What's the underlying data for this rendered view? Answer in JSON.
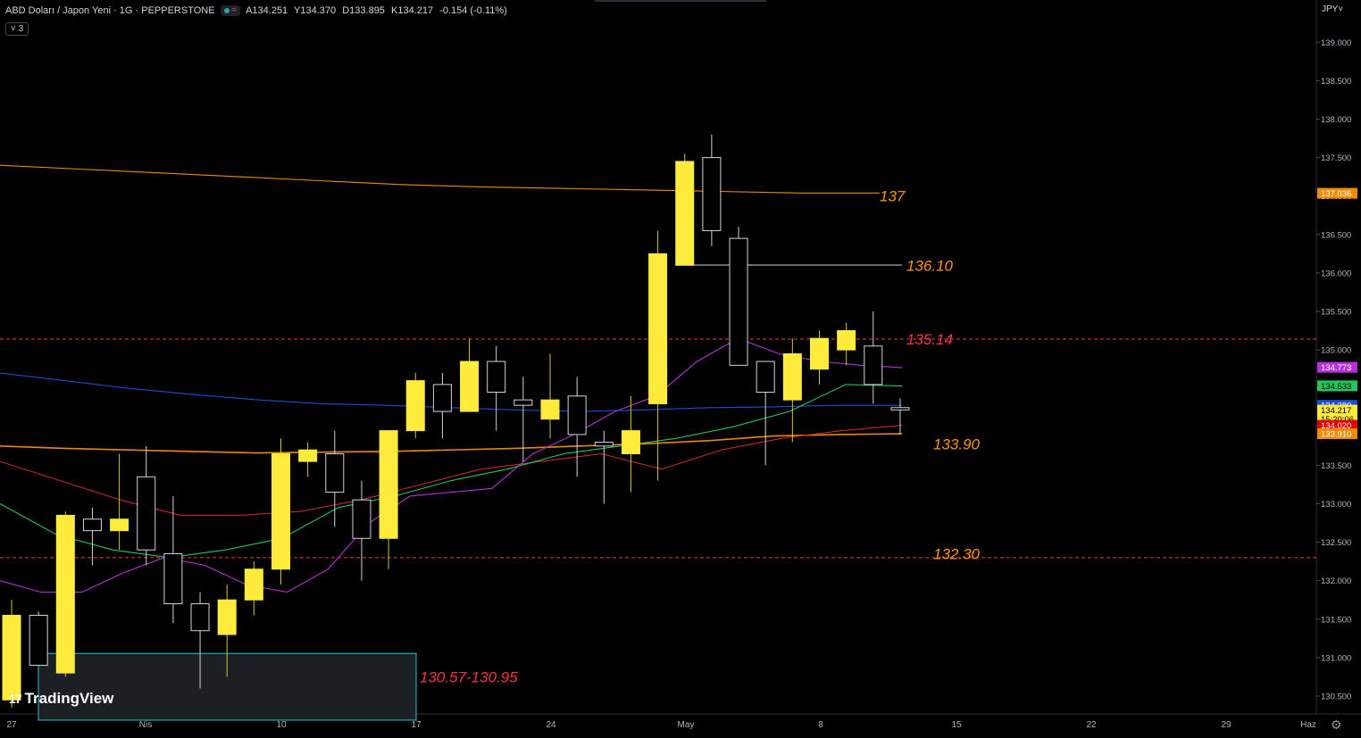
{
  "header": {
    "symbol": "ABD Doları / Japon Yeni · 1G · PEPPERSTONE",
    "ohlc": {
      "open": "A134.251",
      "high": "Y134.370",
      "low": "D133.895",
      "close": "K134.217",
      "change": "-0.154 (-0.11%)"
    },
    "indicator_count": "˅ 3",
    "currency": "JPY˅"
  },
  "branding": {
    "logo_mark": "17",
    "logo_text": "TradingView"
  },
  "colors": {
    "background": "#000000",
    "bull_body": "#ffeb3b",
    "bear_body": "#000000",
    "ma_orange": "#f08c00",
    "ma_blue": "#1a4fd6",
    "ma_red": "#c62828",
    "ma_green": "#22c55e",
    "ma_purple": "#b532d8",
    "annotation_orange": "#ff9800",
    "annotation_red": "#f23645"
  },
  "chart_data": {
    "type": "candlestick",
    "x_ticks": [
      "27",
      "Nis",
      "10",
      "17",
      "24",
      "May",
      "8",
      "15",
      "22",
      "29",
      "Haz"
    ],
    "y_ticks": [
      "130.500",
      "131.000",
      "131.500",
      "132.000",
      "132.500",
      "133.000",
      "133.500",
      "134.000",
      "134.500",
      "135.000",
      "135.500",
      "136.000",
      "136.500",
      "137.000",
      "137.500",
      "138.000",
      "138.500",
      "139.000"
    ],
    "ylim": [
      130.3,
      139.35
    ],
    "candles": [
      {
        "date": "03-23",
        "o": 130.45,
        "h": 131.75,
        "l": 130.35,
        "c": 131.55
      },
      {
        "date": "03-24",
        "o": 131.55,
        "h": 131.6,
        "l": 130.9,
        "c": 130.9
      },
      {
        "date": "03-27",
        "o": 130.8,
        "h": 132.9,
        "l": 130.75,
        "c": 132.85
      },
      {
        "date": "03-28",
        "o": 132.8,
        "h": 132.95,
        "l": 132.2,
        "c": 132.65
      },
      {
        "date": "03-29",
        "o": 132.65,
        "h": 133.65,
        "l": 132.4,
        "c": 132.8
      },
      {
        "date": "03-30",
        "o": 133.35,
        "h": 133.75,
        "l": 132.2,
        "c": 132.4
      },
      {
        "date": "03-31",
        "o": 132.35,
        "h": 133.1,
        "l": 131.45,
        "c": 131.7
      },
      {
        "date": "04-03",
        "o": 131.7,
        "h": 131.85,
        "l": 130.6,
        "c": 131.35
      },
      {
        "date": "04-04",
        "o": 131.3,
        "h": 131.95,
        "l": 130.75,
        "c": 131.75
      },
      {
        "date": "04-05",
        "o": 131.75,
        "h": 132.25,
        "l": 131.55,
        "c": 132.15
      },
      {
        "date": "04-06",
        "o": 132.15,
        "h": 133.85,
        "l": 131.95,
        "c": 133.65
      },
      {
        "date": "04-07",
        "o": 133.55,
        "h": 133.8,
        "l": 133.35,
        "c": 133.7
      },
      {
        "date": "04-10",
        "o": 133.65,
        "h": 133.95,
        "l": 132.7,
        "c": 133.15
      },
      {
        "date": "04-11",
        "o": 133.05,
        "h": 133.3,
        "l": 132.0,
        "c": 132.55
      },
      {
        "date": "04-12",
        "o": 132.55,
        "h": 133.95,
        "l": 132.15,
        "c": 133.95
      },
      {
        "date": "04-13",
        "o": 133.95,
        "h": 134.7,
        "l": 133.85,
        "c": 134.6
      },
      {
        "date": "04-14",
        "o": 134.55,
        "h": 134.7,
        "l": 133.85,
        "c": 134.2
      },
      {
        "date": "04-17",
        "o": 134.2,
        "h": 135.15,
        "l": 134.2,
        "c": 134.85
      },
      {
        "date": "04-18",
        "o": 134.85,
        "h": 135.05,
        "l": 133.95,
        "c": 134.45
      },
      {
        "date": "04-19",
        "o": 134.35,
        "h": 134.65,
        "l": 133.55,
        "c": 134.28
      },
      {
        "date": "04-20",
        "o": 134.1,
        "h": 134.95,
        "l": 133.85,
        "c": 134.35
      },
      {
        "date": "04-21",
        "o": 134.4,
        "h": 134.65,
        "l": 133.35,
        "c": 133.9
      },
      {
        "date": "04-24",
        "o": 133.8,
        "h": 133.95,
        "l": 133.0,
        "c": 133.75
      },
      {
        "date": "04-25",
        "o": 133.65,
        "h": 134.4,
        "l": 133.15,
        "c": 133.95
      },
      {
        "date": "04-26",
        "o": 134.3,
        "h": 136.55,
        "l": 133.3,
        "c": 136.25
      },
      {
        "date": "04-27",
        "o": 136.1,
        "h": 137.55,
        "l": 136.1,
        "c": 137.45
      },
      {
        "date": "04-28",
        "o": 137.5,
        "h": 137.8,
        "l": 136.35,
        "c": 136.55
      },
      {
        "date": "05-01",
        "o": 136.45,
        "h": 136.6,
        "l": 135.15,
        "c": 134.8
      },
      {
        "date": "05-02",
        "o": 134.85,
        "h": 134.85,
        "l": 133.5,
        "c": 134.45
      },
      {
        "date": "05-03",
        "o": 134.35,
        "h": 135.15,
        "l": 133.8,
        "c": 134.95
      },
      {
        "date": "05-04",
        "o": 134.75,
        "h": 135.25,
        "l": 134.55,
        "c": 135.15
      },
      {
        "date": "05-05",
        "o": 135.0,
        "h": 135.35,
        "l": 134.8,
        "c": 135.25
      },
      {
        "date": "05-08",
        "o": 135.05,
        "h": 135.5,
        "l": 134.3,
        "c": 134.55
      },
      {
        "date": "05-09",
        "o": 134.25,
        "h": 134.37,
        "l": 133.9,
        "c": 134.22
      }
    ],
    "moving_averages": [
      {
        "color": "#f08c00",
        "values": [
          137.4,
          137.35,
          137.3,
          137.25,
          137.2,
          137.15,
          137.12,
          137.1,
          137.08,
          137.06,
          137.04,
          137.04
        ]
      },
      {
        "color": "#1a4fd6",
        "values": [
          134.7,
          134.6,
          134.5,
          134.42,
          134.35,
          134.3,
          134.28,
          134.25,
          134.22,
          134.2,
          134.22,
          134.25,
          134.26,
          134.28,
          134.28
        ]
      },
      {
        "color": "#e8870e",
        "values": [
          133.75,
          133.72,
          133.7,
          133.68,
          133.66,
          133.67,
          133.68,
          133.7,
          133.72,
          133.75,
          133.78,
          133.82,
          133.88,
          133.9,
          133.91
        ]
      },
      {
        "color": "#c62828",
        "values": [
          133.55,
          133.3,
          133.05,
          132.85,
          132.85,
          132.9,
          133.05,
          133.25,
          133.45,
          133.55,
          133.65,
          133.45,
          133.7,
          133.85,
          133.95,
          134.02
        ]
      },
      {
        "color": "#22c55e",
        "values": [
          133.0,
          132.6,
          132.4,
          132.3,
          132.4,
          132.55,
          132.95,
          133.1,
          133.3,
          133.45,
          133.65,
          133.75,
          133.85,
          134.0,
          134.2,
          134.55,
          134.53
        ]
      },
      {
        "color": "#b532d8",
        "values": [
          132.0,
          131.85,
          131.85,
          132.1,
          132.3,
          132.2,
          131.95,
          131.85,
          132.15,
          132.75,
          133.1,
          133.15,
          133.2,
          133.65,
          133.9,
          134.2,
          134.4,
          134.85,
          135.15,
          134.95,
          134.85,
          134.8,
          134.77
        ]
      }
    ],
    "right_labels": [
      {
        "text": "137.036",
        "color": "#f08c00",
        "value": 137.036
      },
      {
        "text": "134.773",
        "color": "#b532d8",
        "value": 134.773
      },
      {
        "text": "134.533",
        "color": "#22c55e",
        "value": 134.533
      },
      {
        "text": "134.280",
        "color": "#1a4fd6",
        "value": 134.28
      },
      {
        "text": "134.217",
        "color": "#ffeb3b",
        "value": 134.217
      },
      {
        "text": "15:20:06",
        "color": "#ffeb3b",
        "value": 134.1
      },
      {
        "text": "134.020",
        "color": "#e00000",
        "value": 134.02
      },
      {
        "text": "133.910",
        "color": "#f08c00",
        "value": 133.91
      }
    ],
    "annotations": [
      {
        "text": "137",
        "value": 137.0,
        "color": "#ff9800"
      },
      {
        "text": "136.10",
        "value": 136.1,
        "color": "#ff9800"
      },
      {
        "text": "135.14",
        "value": 135.14,
        "color": "#f23645"
      },
      {
        "text": "133.90",
        "value": 133.78,
        "color": "#ff9800"
      },
      {
        "text": "132.30",
        "value": 132.35,
        "color": "#ff9800"
      },
      {
        "text": "130.57-130.95",
        "value": 130.75,
        "color": "#f23645"
      }
    ],
    "horizontal_lines": [
      {
        "value": 135.14,
        "color": "#f23645",
        "style": "dashed"
      },
      {
        "value": 132.3,
        "color": "#f23645",
        "style": "dashed"
      }
    ],
    "zone": {
      "from": 130.57,
      "to": 130.95,
      "color": "#26c6da"
    }
  }
}
